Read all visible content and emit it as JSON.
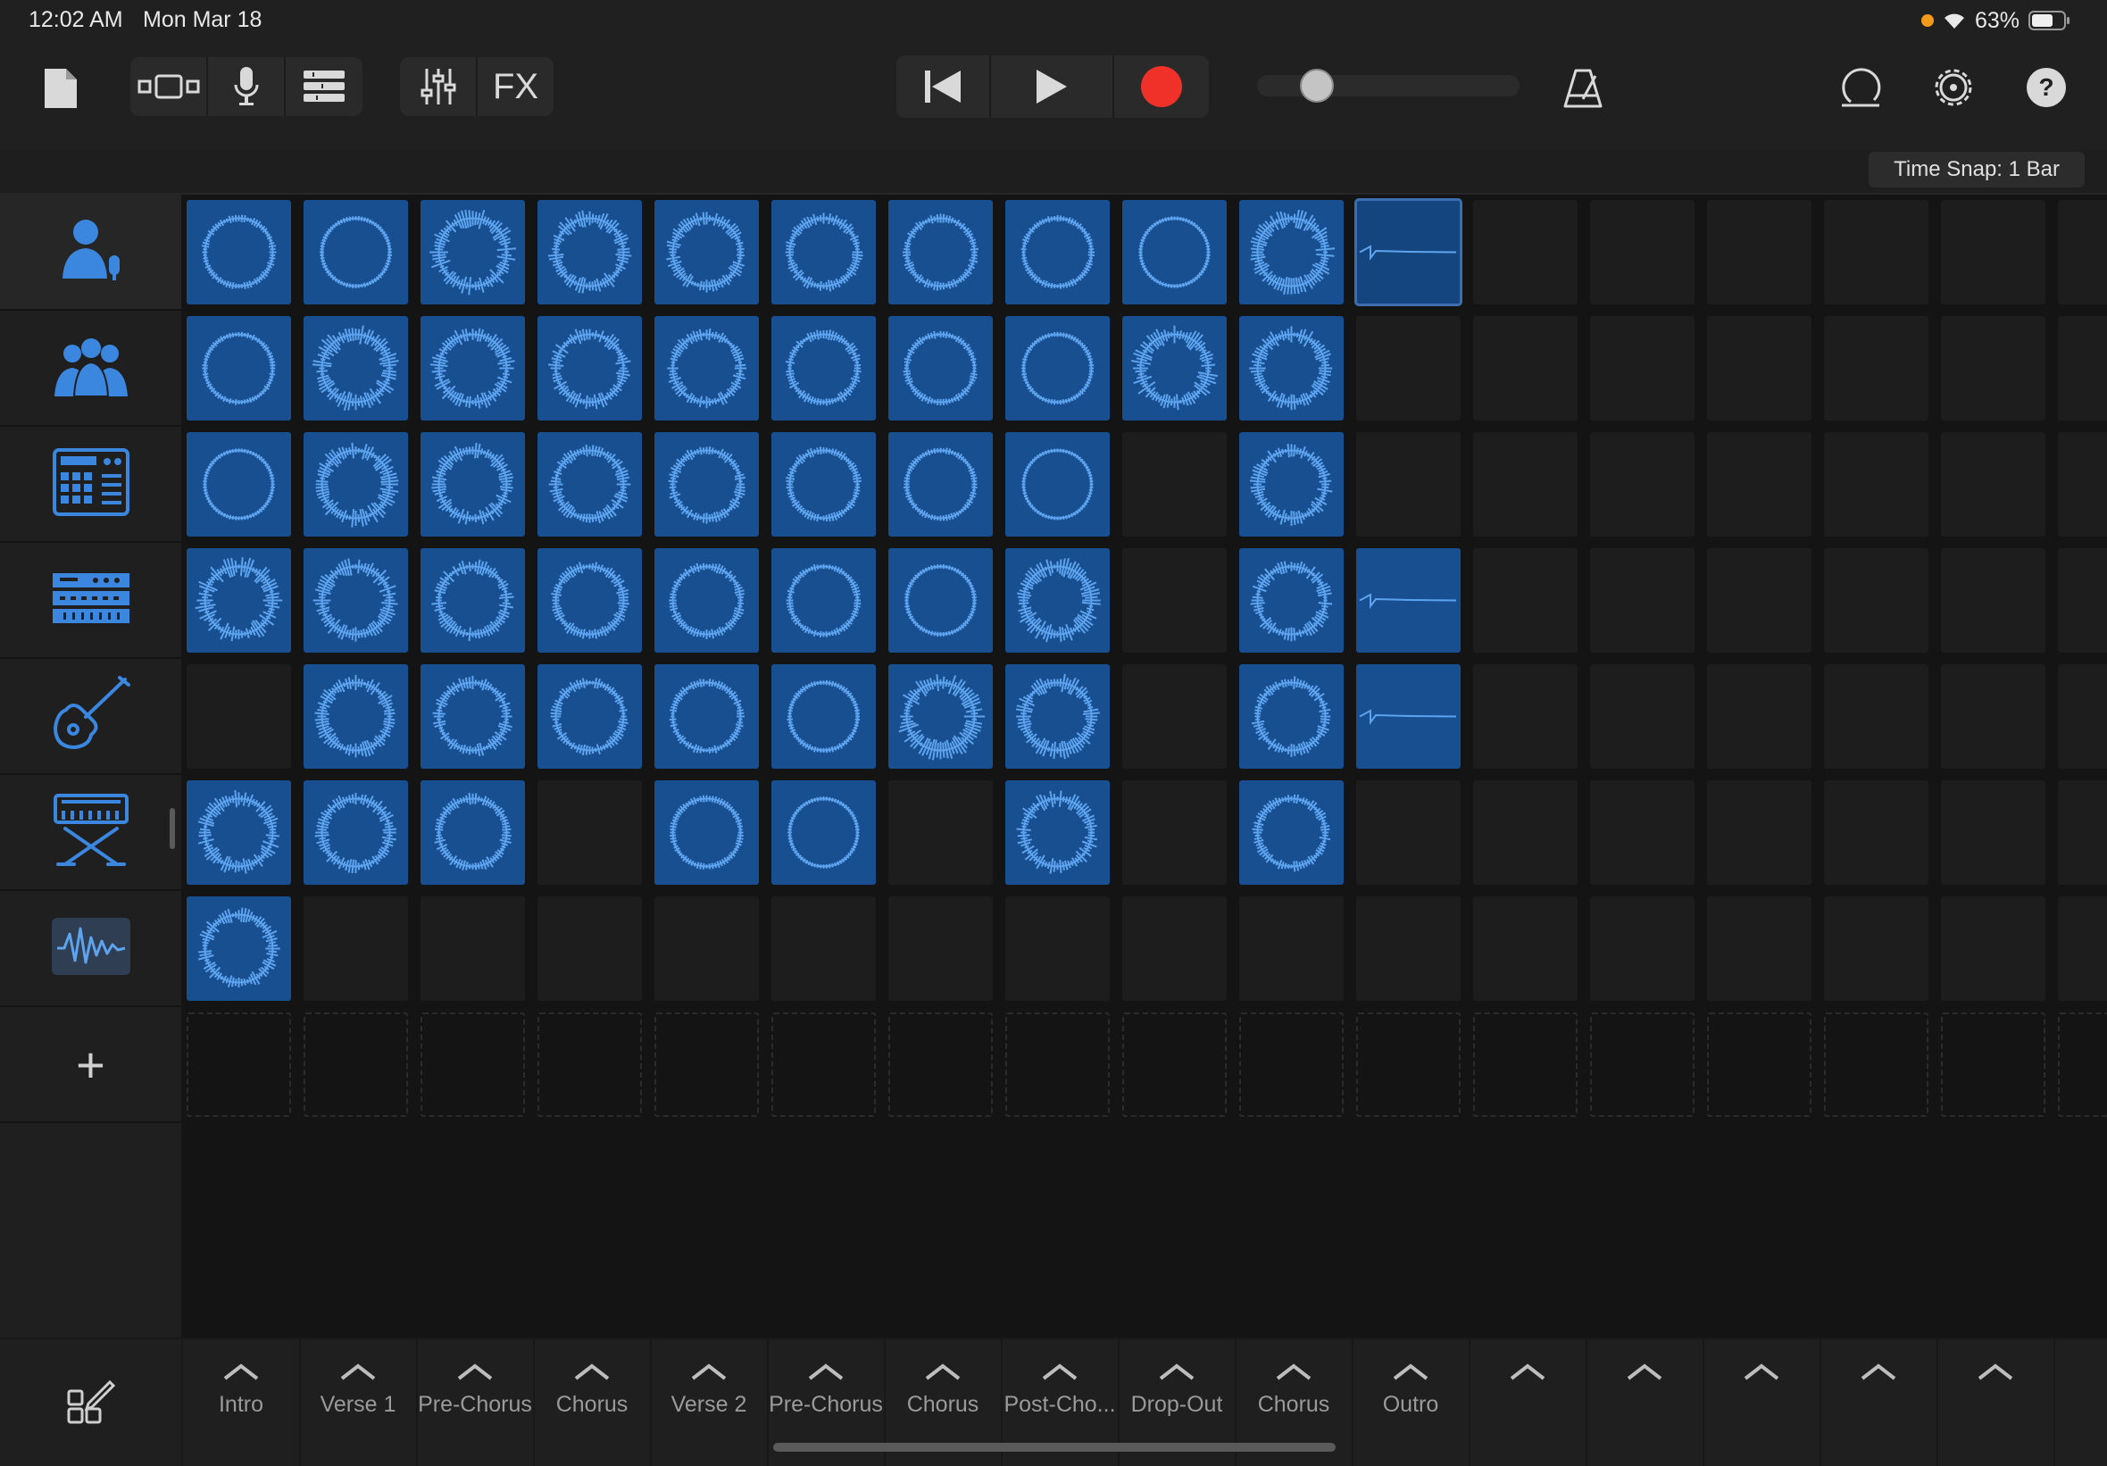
{
  "status": {
    "time": "12:02 AM",
    "date": "Mon Mar 18",
    "battery": "63%"
  },
  "toolbar": {
    "fx_label": "FX",
    "icons": [
      "document-icon",
      "view-toggle-icon",
      "microphone-icon",
      "tracks-view-icon",
      "mixer-icon",
      "go-to-start-icon",
      "play-icon",
      "record-icon",
      "metronome-icon",
      "loop-browser-icon",
      "settings-icon",
      "help-icon"
    ],
    "record_color": "#f0312a"
  },
  "timesnap": {
    "label": "Time Snap: 1 Bar"
  },
  "tracks": [
    {
      "name": "vocalist-track",
      "icon": "singer-icon"
    },
    {
      "name": "choir-track",
      "icon": "choir-icon"
    },
    {
      "name": "drum-machine-track",
      "icon": "drum-machine-icon"
    },
    {
      "name": "synth-track",
      "icon": "synth-module-icon"
    },
    {
      "name": "guitar-track",
      "icon": "guitar-icon"
    },
    {
      "name": "keyboard-track",
      "icon": "keyboard-stand-icon"
    },
    {
      "name": "audio-track",
      "icon": "waveform-icon"
    }
  ],
  "add_track_label": "+",
  "grid_rows": [
    [
      "s",
      "s",
      "s",
      "s",
      "s",
      "s",
      "s",
      "s",
      "s",
      "s",
      "l",
      "e",
      "e",
      "e",
      "e",
      "e",
      "e"
    ],
    [
      "s",
      "s",
      "s",
      "s",
      "s",
      "s",
      "s",
      "s",
      "s",
      "s",
      "e",
      "e",
      "e",
      "e",
      "e",
      "e",
      "e"
    ],
    [
      "s",
      "s",
      "s",
      "s",
      "s",
      "s",
      "s",
      "s",
      "e",
      "s",
      "e",
      "e",
      "e",
      "e",
      "e",
      "e",
      "e"
    ],
    [
      "s",
      "s",
      "s",
      "s",
      "s",
      "s",
      "s",
      "s",
      "e",
      "s",
      "l",
      "e",
      "e",
      "e",
      "e",
      "e",
      "e"
    ],
    [
      "e",
      "s",
      "s",
      "s",
      "s",
      "s",
      "s",
      "s",
      "e",
      "s",
      "l",
      "e",
      "e",
      "e",
      "e",
      "e",
      "e"
    ],
    [
      "s",
      "s",
      "s",
      "e",
      "s",
      "s",
      "e",
      "s",
      "e",
      "s",
      "e",
      "e",
      "e",
      "e",
      "e",
      "e",
      "e"
    ],
    [
      "s",
      "e",
      "e",
      "e",
      "e",
      "e",
      "e",
      "e",
      "e",
      "e",
      "e",
      "e",
      "e",
      "e",
      "e",
      "e",
      "e"
    ]
  ],
  "scenes": [
    "Intro",
    "Verse 1",
    "Pre-Chorus",
    "Chorus",
    "Verse 2",
    "Pre-Chorus",
    "Chorus",
    "Post-Cho...",
    "Drop-Out",
    "Chorus",
    "Outro",
    "",
    "",
    "",
    "",
    ""
  ],
  "accent": "#174f91",
  "clip_wave_color": "#5ea3ee"
}
